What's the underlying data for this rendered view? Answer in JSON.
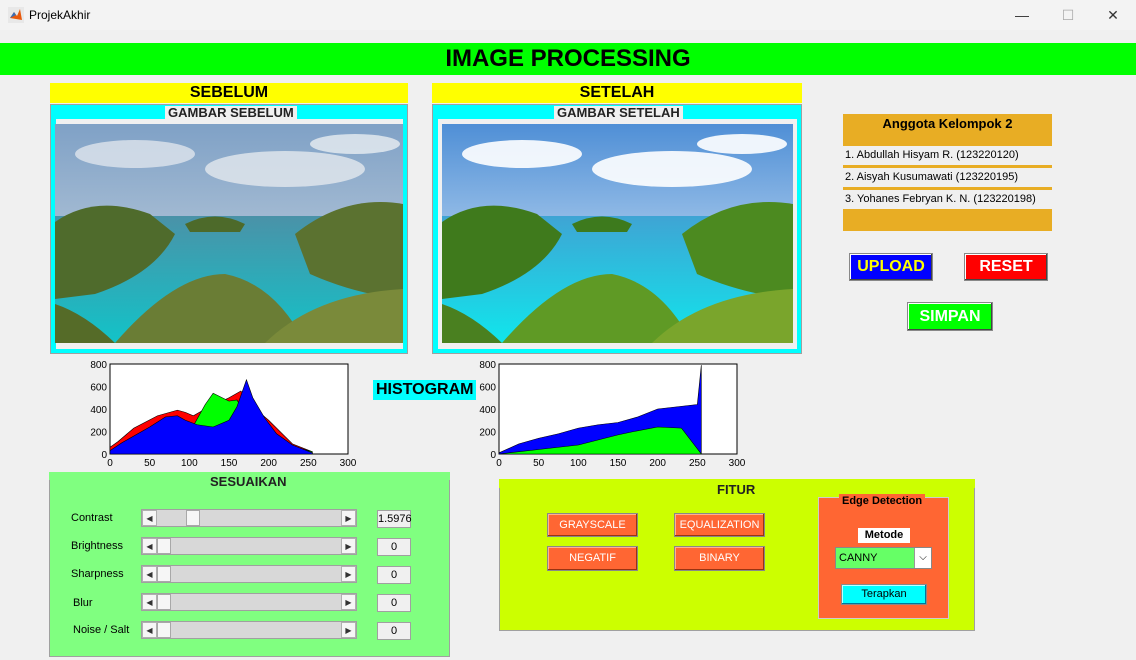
{
  "window": {
    "title": "ProjekAkhir",
    "minimize": "—",
    "maximize": "☐",
    "close": "✕"
  },
  "banner": {
    "title": "IMAGE PROCESSING"
  },
  "before": {
    "header": "SEBELUM",
    "panel_title": "GAMBAR SEBELUM"
  },
  "after": {
    "header": "SETELAH",
    "panel_title": "GAMBAR SETELAH"
  },
  "histogram_label": "HISTOGRAM",
  "members": {
    "title": "Anggota Kelompok 2",
    "list": [
      "1. Abdullah Hisyam R. (123220120)",
      "2. Aisyah Kusumawati (123220195)",
      "3. Yohanes Febryan K. N. (123220198)"
    ]
  },
  "buttons": {
    "upload": "UPLOAD",
    "reset": "RESET",
    "save": "SIMPAN"
  },
  "adjust": {
    "title": "SESUAIKAN",
    "rows": [
      {
        "label": "Contrast",
        "value": "1.5976"
      },
      {
        "label": "Brightness",
        "value": "0"
      },
      {
        "label": "Sharpness",
        "value": "0"
      },
      {
        "label": "Blur",
        "value": "0"
      },
      {
        "label": "Noise / Salt",
        "value": "0"
      }
    ]
  },
  "fitur": {
    "title": "FITUR",
    "grayscale": "GRAYSCALE",
    "equalization": "EQUALIZATION",
    "negatif": "NEGATIF",
    "binary": "BINARY",
    "edge": {
      "title": "Edge Detection",
      "method_label": "Metode",
      "method_value": "CANNY",
      "apply": "Terapkan"
    }
  },
  "colors": {
    "banner": "#00ff00",
    "label": "#ffff00",
    "frame": "#00ffff",
    "adjust": "#80ff80",
    "fitur": "#ccff00",
    "orange": "#ff6633",
    "members": "#e8ad24",
    "upload": "#0000ff",
    "reset": "#ff0000",
    "save": "#00ff00"
  },
  "chart_data": [
    {
      "type": "area",
      "xlim": [
        0,
        300
      ],
      "ylim": [
        0,
        800
      ],
      "xticks": [
        "0",
        "50",
        "100",
        "150",
        "200",
        "250",
        "300"
      ],
      "yticks": [
        "0",
        "200",
        "400",
        "600",
        "800"
      ],
      "series": [
        {
          "color": "#ff0000",
          "x": [
            0,
            10,
            30,
            60,
            85,
            95,
            105,
            120,
            150,
            165,
            180,
            200,
            230,
            255
          ],
          "values": [
            60,
            110,
            230,
            340,
            390,
            370,
            340,
            400,
            500,
            560,
            420,
            300,
            90,
            20
          ]
        },
        {
          "color": "#00ff00",
          "x": [
            0,
            20,
            40,
            60,
            80,
            95,
            105,
            120,
            130,
            150,
            160,
            175,
            190,
            220,
            255
          ],
          "values": [
            20,
            60,
            120,
            220,
            240,
            200,
            250,
            440,
            540,
            470,
            480,
            300,
            200,
            90,
            20
          ]
        },
        {
          "color": "#0000ff",
          "x": [
            0,
            15,
            30,
            50,
            70,
            85,
            95,
            110,
            130,
            150,
            160,
            172,
            180,
            195,
            210,
            230,
            255
          ],
          "values": [
            30,
            100,
            160,
            240,
            330,
            340,
            300,
            260,
            240,
            300,
            420,
            660,
            500,
            320,
            180,
            80,
            10
          ]
        }
      ]
    },
    {
      "type": "area",
      "xlim": [
        0,
        300
      ],
      "ylim": [
        0,
        800
      ],
      "xticks": [
        "0",
        "50",
        "100",
        "150",
        "200",
        "250",
        "300"
      ],
      "yticks": [
        "0",
        "200",
        "400",
        "600",
        "800"
      ],
      "series": [
        {
          "color": "#0000ff",
          "x": [
            0,
            25,
            50,
            75,
            100,
            125,
            150,
            175,
            200,
            225,
            250,
            255
          ],
          "values": [
            10,
            90,
            140,
            180,
            230,
            260,
            280,
            330,
            400,
            420,
            440,
            790
          ]
        },
        {
          "color": "#00ff00",
          "x": [
            0,
            50,
            100,
            150,
            170,
            200,
            230,
            255
          ],
          "values": [
            0,
            40,
            80,
            170,
            200,
            240,
            230,
            0
          ]
        }
      ]
    }
  ]
}
